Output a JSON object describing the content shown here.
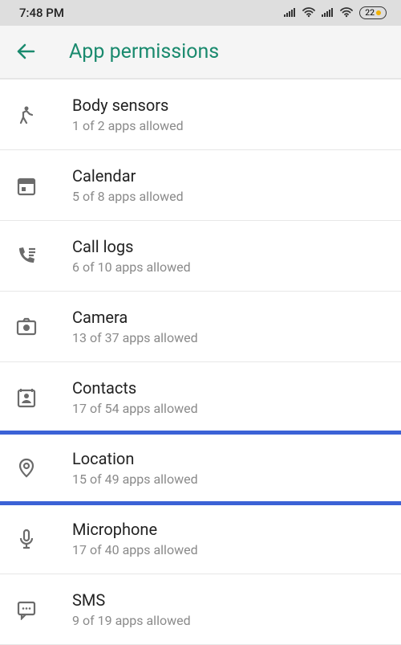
{
  "status": {
    "time": "7:48 PM",
    "battery": "22"
  },
  "header": {
    "title": "App permissions"
  },
  "permissions": [
    {
      "icon": "body-sensors-icon",
      "title": "Body sensors",
      "subtitle": "1 of 2 apps allowed",
      "highlighted": false
    },
    {
      "icon": "calendar-icon",
      "title": "Calendar",
      "subtitle": "5 of 8 apps allowed",
      "highlighted": false
    },
    {
      "icon": "call-logs-icon",
      "title": "Call logs",
      "subtitle": "6 of 10 apps allowed",
      "highlighted": false
    },
    {
      "icon": "camera-icon",
      "title": "Camera",
      "subtitle": "13 of 37 apps allowed",
      "highlighted": false
    },
    {
      "icon": "contacts-icon",
      "title": "Contacts",
      "subtitle": "17 of 54 apps allowed",
      "highlighted": false
    },
    {
      "icon": "location-icon",
      "title": "Location",
      "subtitle": "15 of 49 apps allowed",
      "highlighted": true
    },
    {
      "icon": "microphone-icon",
      "title": "Microphone",
      "subtitle": "17 of 40 apps allowed",
      "highlighted": false
    },
    {
      "icon": "sms-icon",
      "title": "SMS",
      "subtitle": "9 of 19 apps allowed",
      "highlighted": false
    }
  ],
  "colors": {
    "accent": "#1a8a6e",
    "highlight": "#3b62d6",
    "icon": "#6b6b6b",
    "subtext": "#8a8a8a"
  }
}
